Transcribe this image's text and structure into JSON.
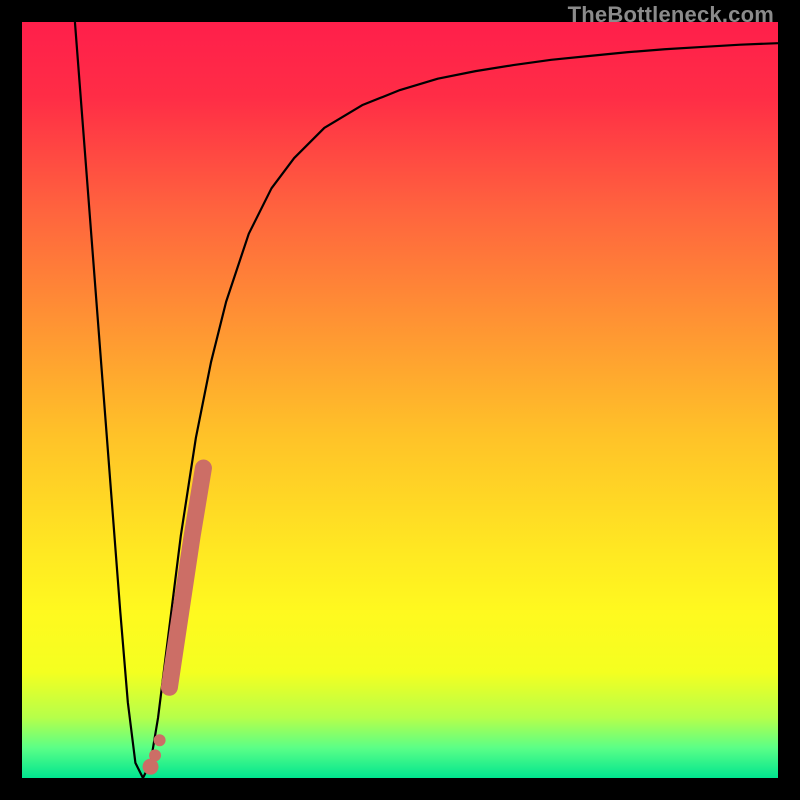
{
  "watermark": "TheBottleneck.com",
  "colors": {
    "bg": "#000000",
    "curve": "#000000",
    "marker": "#cc6e66",
    "gradient_stops": [
      {
        "offset": "0%",
        "color": "#ff1f4b"
      },
      {
        "offset": "10%",
        "color": "#ff2d46"
      },
      {
        "offset": "25%",
        "color": "#ff643e"
      },
      {
        "offset": "40%",
        "color": "#ff9433"
      },
      {
        "offset": "55%",
        "color": "#ffc328"
      },
      {
        "offset": "70%",
        "color": "#ffe822"
      },
      {
        "offset": "78%",
        "color": "#fff91f"
      },
      {
        "offset": "86%",
        "color": "#f4ff20"
      },
      {
        "offset": "92%",
        "color": "#b6ff4a"
      },
      {
        "offset": "96%",
        "color": "#5bff87"
      },
      {
        "offset": "100%",
        "color": "#00e58f"
      }
    ]
  },
  "chart_data": {
    "type": "line",
    "title": "",
    "xlabel": "",
    "ylabel": "",
    "xlim": [
      0,
      100
    ],
    "ylim": [
      0,
      100
    ],
    "series": [
      {
        "name": "bottleneck-curve",
        "x": [
          7,
          8,
          9,
          10,
          11,
          12,
          13,
          14,
          15,
          16,
          17,
          18,
          19,
          20,
          21,
          23,
          25,
          27,
          30,
          33,
          36,
          40,
          45,
          50,
          55,
          60,
          65,
          70,
          75,
          80,
          85,
          90,
          95,
          100
        ],
        "y": [
          100,
          87,
          74,
          61,
          48,
          35,
          22,
          10,
          2,
          0,
          2,
          8,
          16,
          24,
          32,
          45,
          55,
          63,
          72,
          78,
          82,
          86,
          89,
          91,
          92.5,
          93.5,
          94.3,
          95,
          95.5,
          96,
          96.4,
          96.7,
          97,
          97.2
        ]
      }
    ],
    "markers": [
      {
        "x": 17.0,
        "y": 1.5
      },
      {
        "x": 17.6,
        "y": 3.0
      },
      {
        "x": 18.2,
        "y": 5.0
      },
      {
        "x": 19.5,
        "y": 12.0
      },
      {
        "x": 21.0,
        "y": 22.0
      },
      {
        "x": 22.5,
        "y": 32.0
      },
      {
        "x": 24.0,
        "y": 41.0
      }
    ]
  }
}
